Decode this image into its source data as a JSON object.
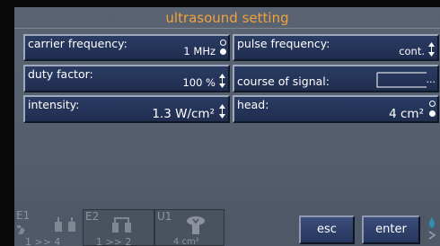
{
  "header": {
    "title": "ultrasound setting"
  },
  "fields": {
    "carrier_frequency": {
      "label": "carrier frequency:",
      "value": "1 MHz"
    },
    "pulse_frequency": {
      "label": "pulse frequency:",
      "value": "cont."
    },
    "duty_factor": {
      "label": "duty factor:",
      "value": "100 %"
    },
    "course_of_signal": {
      "label": "course of signal:",
      "value": "..."
    },
    "intensity": {
      "label": "intensity:",
      "value": "1.3 W/cm²"
    },
    "head": {
      "label": "head:",
      "value": "4 cm²"
    }
  },
  "bottom": {
    "slot_e1": {
      "label": "E1",
      "sub": "1 >> 4"
    },
    "slot_e2": {
      "label": "E2",
      "sub": "1 >> 2"
    },
    "slot_u1": {
      "label": "U1",
      "sub": "4 cm²"
    },
    "esc_label": "esc",
    "enter_label": "enter"
  },
  "colors": {
    "title": "#f2a23a",
    "field_bg": "#22325a",
    "background": "#555e6d"
  }
}
